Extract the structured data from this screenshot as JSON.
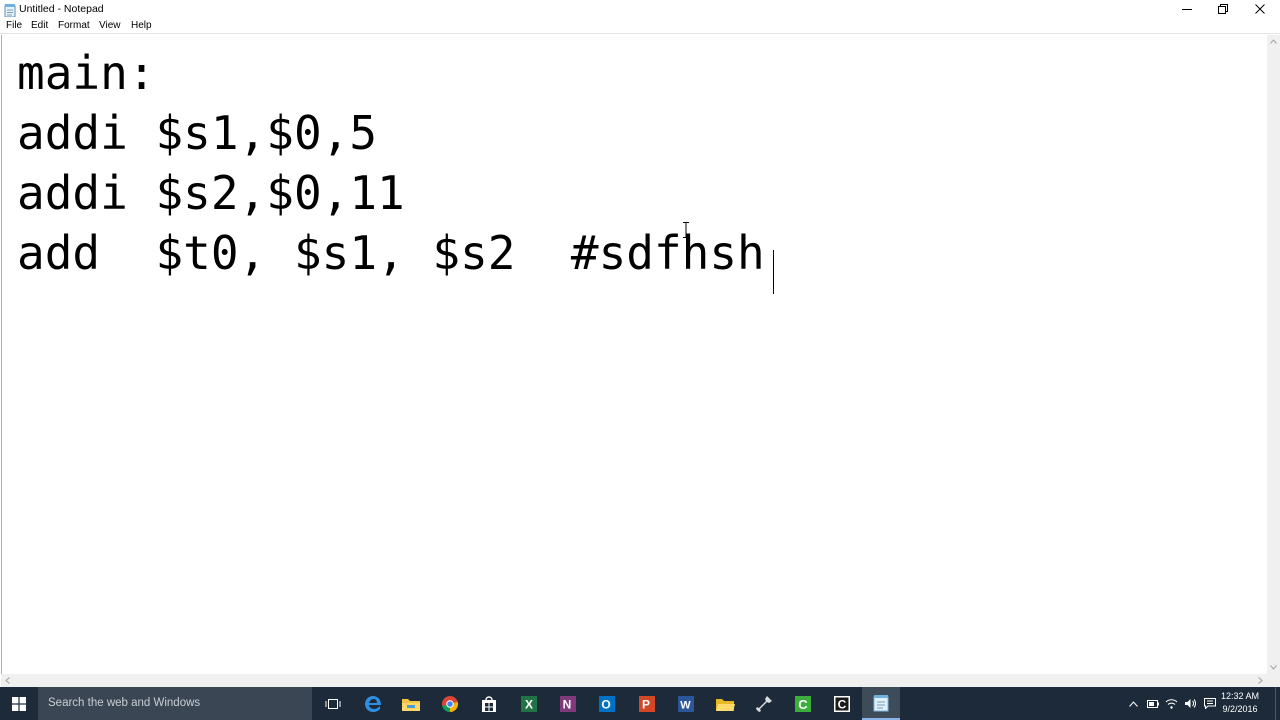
{
  "window": {
    "title": "Untitled - Notepad"
  },
  "menu": [
    "File",
    "Edit",
    "Format",
    "View",
    "Help"
  ],
  "editor": {
    "lines": [
      "main:",
      "addi $s1,$0,5",
      "addi $s2,$0,11",
      "add  $t0, $s1, $s2  #sdfhsh"
    ]
  },
  "taskbar": {
    "search_placeholder": "Search the web and Windows",
    "pinned": [
      "task-view-icon",
      "edge-icon",
      "file-explorer-icon",
      "chrome-icon",
      "store-icon",
      "excel-icon",
      "onenote-icon",
      "outlook-icon",
      "powerpoint-icon",
      "word-icon",
      "folder-icon",
      "tool-icon",
      "app-c-green-icon",
      "app-c-dark-icon",
      "notepad-icon"
    ],
    "clock": {
      "time": "12:32 AM",
      "date": "9/2/2016"
    }
  },
  "colors": {
    "taskbar_bg": "#1c2a39",
    "search_bg": "#3a4653",
    "active_indicator": "#8ab4e6"
  }
}
